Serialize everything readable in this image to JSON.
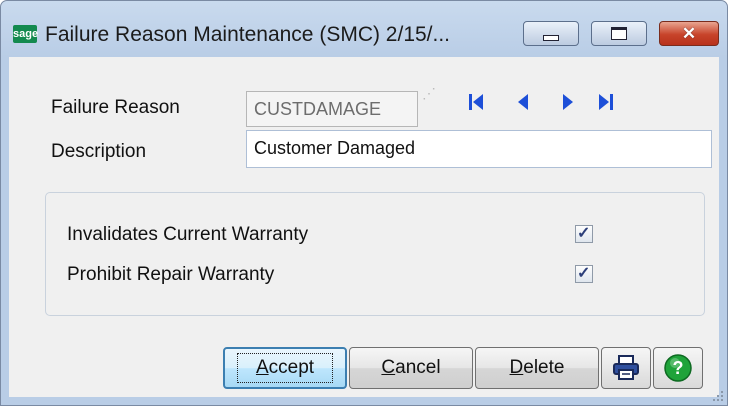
{
  "window": {
    "app_icon_text": "sage",
    "title": "Failure Reason Maintenance (SMC) 2/15/..."
  },
  "form": {
    "failure_reason_label": "Failure Reason",
    "failure_reason_value": "CUSTDAMAGE",
    "description_label": "Description",
    "description_value": "Customer Damaged"
  },
  "navigation": {
    "icons": [
      "first-record-icon",
      "previous-record-icon",
      "next-record-icon",
      "last-record-icon"
    ]
  },
  "options": {
    "invalidates_label": "Invalidates Current Warranty",
    "invalidates_checked": true,
    "prohibit_label": "Prohibit Repair Warranty",
    "prohibit_checked": true,
    "check_glyph": "✓"
  },
  "buttons": {
    "accept_first": "A",
    "accept_rest": "ccept",
    "cancel_first": "C",
    "cancel_rest": "ancel",
    "delete_first": "D",
    "delete_rest": "elete",
    "print_icon": "printer-icon",
    "help_icon": "help-icon"
  },
  "colors": {
    "nav_arrows": "#1d4fd8",
    "help_green": "#1fa33a",
    "title_bar": "#b9cde6",
    "close_red": "#c7432a"
  }
}
